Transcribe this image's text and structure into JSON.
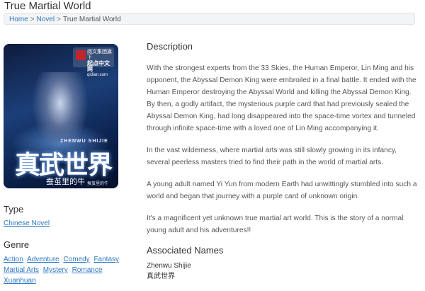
{
  "page": {
    "title": "True Martial World"
  },
  "breadcrumb": {
    "home": "Home",
    "separator": ">",
    "novel": "Novel",
    "current": "True Martial World"
  },
  "cover": {
    "logo_text_line1": "阅文集团旗下",
    "logo_text_line2": "起点中文网",
    "logo_text_line3": "qidian.com",
    "subtitle_en": "ZHENWU SHIJIE",
    "title_cn": "真武世界",
    "author": "蚕茧里的牛",
    "wechat": "蚕茧里的牛"
  },
  "type": {
    "heading": "Type",
    "value": "Chinese Novel"
  },
  "genre": {
    "heading": "Genre",
    "items": [
      "Action",
      "Adventure",
      "Comedy",
      "Fantasy",
      "Martial Arts",
      "Mystery",
      "Romance",
      "Xuanhuan"
    ]
  },
  "description": {
    "heading": "Description",
    "paragraphs": [
      "With the strongest experts from the 33 Skies, the Human Emperor, Lin Ming and his opponent, the Abyssal Demon King were embroiled in a final battle. It ended with the Human Emperor destroying the Abyssal World and killing the Abyssal Demon King. By then, a godly artifact, the mysterious purple card that had previously sealed the Abyssal Demon King, had long disappeared into the space-time vortex and tunneled through infinite space-time with a loved one of Lin Ming accompanying it.",
      "In the vast wilderness, where martial arts was still slowly growing in its infancy, several peerless masters tried to find their path in the world of martial arts.",
      "A young adult named Yi Yun from modern Earth had unwittingly stumbled into such a world and began that journey with a purple card of unknown origin.",
      "It's a magnificent yet unknown true martial art world. This is the story of a normal young adult and his adventures!!"
    ]
  },
  "associated": {
    "heading": "Associated Names",
    "names": [
      "Zhenwu Shijie",
      "真武世界"
    ]
  }
}
